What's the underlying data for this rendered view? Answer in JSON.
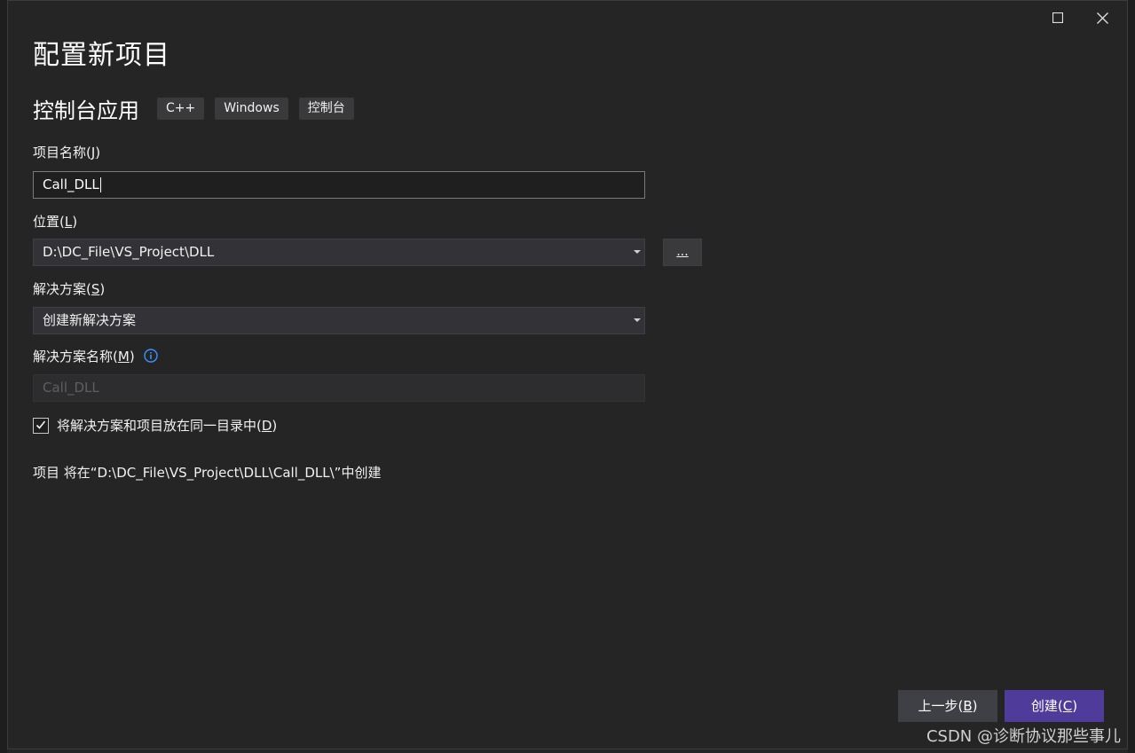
{
  "dialog": {
    "title": "配置新项目",
    "template_name": "控制台应用",
    "tags": [
      "C++",
      "Windows",
      "控制台"
    ]
  },
  "project_name": {
    "label": "项目名称(",
    "accel": "J",
    "label_end": ")",
    "value": "Call_DLL"
  },
  "location": {
    "label": "位置(",
    "accel": "L",
    "label_end": ")",
    "value": "D:\\DC_File\\VS_Project\\DLL",
    "browse_label": "..."
  },
  "solution": {
    "label": "解决方案(",
    "accel": "S",
    "label_end": ")",
    "value": "创建新解决方案"
  },
  "solution_name": {
    "label": "解决方案名称(",
    "accel": "M",
    "label_end": ")",
    "value": "Call_DLL"
  },
  "same_dir": {
    "checked": true,
    "label": "将解决方案和项目放在同一目录中(",
    "accel": "D",
    "label_end": ")"
  },
  "path_note": "项目 将在“D:\\DC_File\\VS_Project\\DLL\\Call_DLL\\”中创建",
  "footer": {
    "back_label": "上一步(",
    "back_accel": "B",
    "back_end": ")",
    "create_label": "创建(",
    "create_accel": "C",
    "create_end": ")"
  },
  "watermark": "CSDN @诊断协议那些事儿",
  "icons": {
    "maximize": "maximize-icon",
    "close": "close-icon",
    "info": "info-icon",
    "check": "check-icon",
    "dropdown": "chevron-down-icon"
  },
  "colors": {
    "background": "#252526",
    "create_button": "#4e3b9a",
    "info_icon": "#3794ff"
  }
}
